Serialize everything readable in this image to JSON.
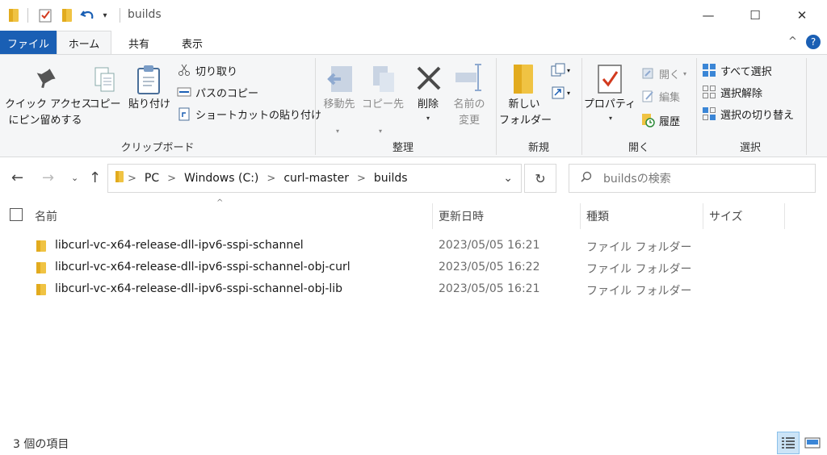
{
  "window": {
    "title": "builds",
    "minimize_glyph": "—",
    "maximize_glyph": "☐",
    "close_glyph": "✕"
  },
  "ribbon_tabs": {
    "file": "ファイル",
    "home": "ホーム",
    "share": "共有",
    "view": "表示",
    "collapse_glyph": "^",
    "help_glyph": "?"
  },
  "clipboard": {
    "pin_line1": "クイック アクセス",
    "pin_line2": "にピン留めする",
    "copy": "コピー",
    "paste": "貼り付け",
    "cut": "切り取り",
    "copy_path": "パスのコピー",
    "paste_shortcut": "ショートカットの貼り付け",
    "group": "クリップボード"
  },
  "organize": {
    "move_to": "移動先",
    "copy_to": "コピー先",
    "delete": "削除",
    "rename_line1": "名前の",
    "rename_line2": "変更",
    "group": "整理"
  },
  "new": {
    "new_folder_line1": "新しい",
    "new_folder_line2": "フォルダー",
    "group": "新規"
  },
  "open": {
    "properties": "プロパティ",
    "open": "開く",
    "edit": "編集",
    "history": "履歴",
    "group": "開く"
  },
  "select": {
    "select_all": "すべて選択",
    "select_none": "選択解除",
    "invert": "選択の切り替え",
    "group": "選択"
  },
  "address": {
    "crumbs": [
      "PC",
      "Windows (C:)",
      "curl-master",
      "builds"
    ],
    "search_placeholder": "buildsの検索"
  },
  "columns": {
    "name": "名前",
    "date": "更新日時",
    "type": "種類",
    "size": "サイズ"
  },
  "files": [
    {
      "name": "libcurl-vc-x64-release-dll-ipv6-sspi-schannel",
      "date": "2023/05/05 16:21",
      "type": "ファイル フォルダー"
    },
    {
      "name": "libcurl-vc-x64-release-dll-ipv6-sspi-schannel-obj-curl",
      "date": "2023/05/05 16:22",
      "type": "ファイル フォルダー"
    },
    {
      "name": "libcurl-vc-x64-release-dll-ipv6-sspi-schannel-obj-lib",
      "date": "2023/05/05 16:21",
      "type": "ファイル フォルダー"
    }
  ],
  "status": {
    "count": "3 個の項目"
  },
  "colors": {
    "accent": "#1a5fb4",
    "folder": "#f0c343",
    "ribbon_bg": "#f5f6f7",
    "selected_view": "#cce4f7"
  }
}
